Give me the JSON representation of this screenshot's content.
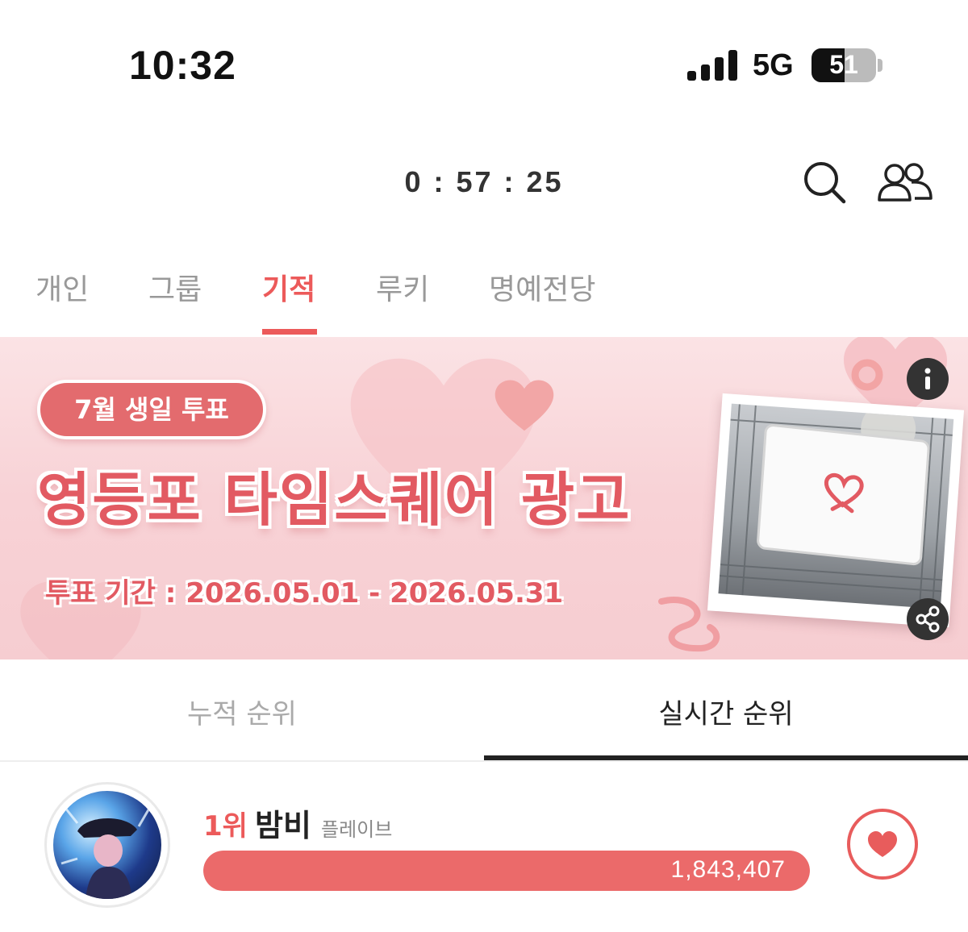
{
  "status_bar": {
    "time": "10:32",
    "network": "5G",
    "battery_percent": "51",
    "battery_level": 0.51,
    "signal_bars": 4
  },
  "header": {
    "countdown": "0 : 57 : 25",
    "icons": [
      "search-icon",
      "people-icon"
    ]
  },
  "category_tabs": [
    {
      "label": "개인",
      "active": false
    },
    {
      "label": "그룹",
      "active": false
    },
    {
      "label": "기적",
      "active": true
    },
    {
      "label": "루키",
      "active": false
    },
    {
      "label": "명예전당",
      "active": false
    }
  ],
  "banner": {
    "badge": "7월 생일 투표",
    "title": "영등포 타임스퀘어 광고",
    "period": "투표 기간 : 2026.05.01 - 2026.05.31",
    "icons": [
      "info-icon",
      "share-icon"
    ]
  },
  "ranking_tabs": [
    {
      "label": "누적 순위",
      "active": false
    },
    {
      "label": "실시간 순위",
      "active": true
    }
  ],
  "entries": [
    {
      "rank": "1위",
      "name": "밤비",
      "group": "플레이브",
      "votes": "1,843,407",
      "bar_fill": 1.0
    }
  ],
  "colors": {
    "accent": "#ec5a5a",
    "bar_fill": "#eb6a6a",
    "banner_bg": "#f8d2d6",
    "text_dark": "#222222",
    "text_muted": "#999999"
  }
}
